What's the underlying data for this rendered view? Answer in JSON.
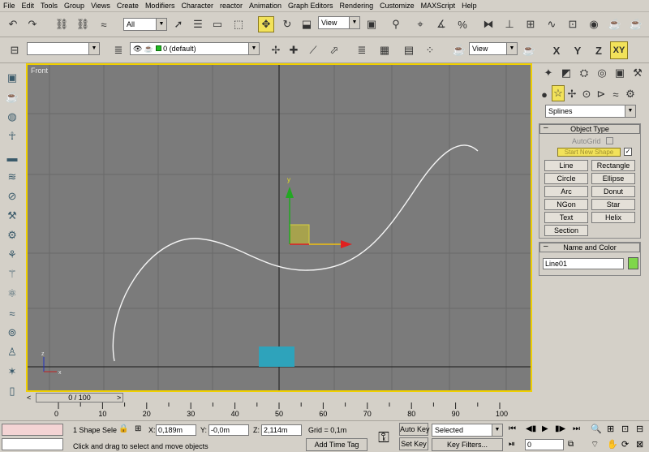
{
  "menu": [
    "File",
    "Edit",
    "Tools",
    "Group",
    "Views",
    "Create",
    "Modifiers",
    "Character",
    "reactor",
    "Animation",
    "Graph Editors",
    "Rendering",
    "Customize",
    "MAXScript",
    "Help"
  ],
  "toolbar1": {
    "selection_filter": "All",
    "ref_coord": "View",
    "icons": [
      "undo-icon",
      "redo-icon",
      "link-icon",
      "unlink-icon",
      "bind-spacewarp-icon",
      "select-icon",
      "select-by-name-icon",
      "rect-selection-icon",
      "window-crossing-icon",
      "move-icon",
      "rotate-icon",
      "scale-icon",
      "pivot-icon",
      "manipulate-icon",
      "snap-icon",
      "angle-snap-icon",
      "percent-snap-icon",
      "spinner-snap-icon",
      "named-selection-icon",
      "mirror-icon",
      "align-icon",
      "layer-manager-icon",
      "curve-editor-icon",
      "schematic-icon",
      "material-editor-icon",
      "render-scene-icon",
      "quick-render-icon"
    ]
  },
  "toolbar2": {
    "named_selection": "",
    "layer": "0 (default)",
    "view": "View",
    "axis_buttons": [
      "X",
      "Y",
      "Z",
      "XY"
    ],
    "active_axis": "XY"
  },
  "viewport": {
    "label": "Front",
    "axis_gizmo": {
      "y": "y",
      "z": "z",
      "x": "x"
    },
    "colors": {
      "background": "#7b7b7b",
      "grid": "#6a6a6a",
      "spline": "#f4f4f4",
      "box": "#2ea3bb",
      "gizmo_y": "#22a822",
      "gizmo_x": "#e02020",
      "gizmo_plane": "#a7a24d",
      "border": "#f0d000"
    }
  },
  "command_panel": {
    "category": "Splines",
    "object_type": {
      "title": "Object Type",
      "autogrid_label": "AutoGrid",
      "start_new_shape": "Start New Shape",
      "buttons": [
        "Line",
        "Rectangle",
        "Circle",
        "Ellipse",
        "Arc",
        "Donut",
        "NGon",
        "Star",
        "Text",
        "Helix",
        "Section"
      ]
    },
    "name_and_color": {
      "title": "Name and Color",
      "name": "Line01",
      "color": "#7fd64a"
    }
  },
  "timeline": {
    "slider_label": "0 / 100",
    "ticks": [
      "0",
      "10",
      "20",
      "30",
      "40",
      "50",
      "60",
      "70",
      "80",
      "90",
      "100"
    ]
  },
  "status": {
    "selection_count": "1 Shape Sele",
    "x_label": "X:",
    "x_value": "0,189m",
    "y_label": "Y:",
    "y_value": "-0,0m",
    "z_label": "Z:",
    "z_value": "2,114m",
    "grid": "Grid = 0,1m",
    "prompt": "Click and drag to select and move objects",
    "add_time_tag": "Add Time Tag",
    "auto_key": "Auto Key",
    "set_key": "Set Key",
    "key_mode": "Selected",
    "key_filters": "Key Filters...",
    "frame": "0"
  }
}
